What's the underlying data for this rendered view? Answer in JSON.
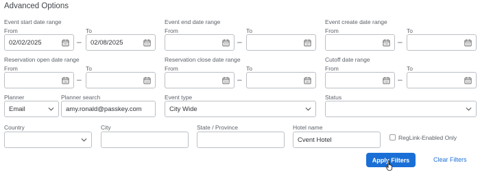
{
  "title": "Advanced Options",
  "common": {
    "from": "From",
    "to": "To"
  },
  "groups": {
    "event_start": {
      "label": "Event start date range",
      "from_value": "02/02/2025",
      "to_value": "02/08/2025"
    },
    "event_end": {
      "label": "Event end date range",
      "from_value": "",
      "to_value": ""
    },
    "event_create": {
      "label": "Event create date range",
      "from_value": "",
      "to_value": ""
    },
    "res_open": {
      "label": "Reservation open date range",
      "from_value": "",
      "to_value": ""
    },
    "res_close": {
      "label": "Reservation close date range",
      "from_value": "",
      "to_value": ""
    },
    "cutoff": {
      "label": "Cutoff date range",
      "from_value": "",
      "to_value": ""
    }
  },
  "planner": {
    "label": "Planner",
    "value": "Email"
  },
  "planner_search": {
    "label": "Planner search",
    "value": "amy.ronald@passkey.com"
  },
  "event_type": {
    "label": "Event type",
    "value": "City Wide"
  },
  "status": {
    "label": "Status",
    "value": ""
  },
  "country": {
    "label": "Country",
    "value": ""
  },
  "city": {
    "label": "City",
    "value": ""
  },
  "state": {
    "label": "State / Province",
    "value": ""
  },
  "hotel_name": {
    "label": "Hotel name",
    "value": "Cvent Hotel"
  },
  "reglink": {
    "label": "RegLink-Enabled Only",
    "checked": false
  },
  "buttons": {
    "apply": "Apply Filters",
    "clear": "Clear Filters"
  },
  "icons": {
    "calendar": "calendar-icon",
    "chevron": "chevron-down-icon",
    "cursor": "hand-pointer-cursor-icon"
  },
  "colors": {
    "accent": "#1a6fd6",
    "border": "#b9bfc6"
  }
}
